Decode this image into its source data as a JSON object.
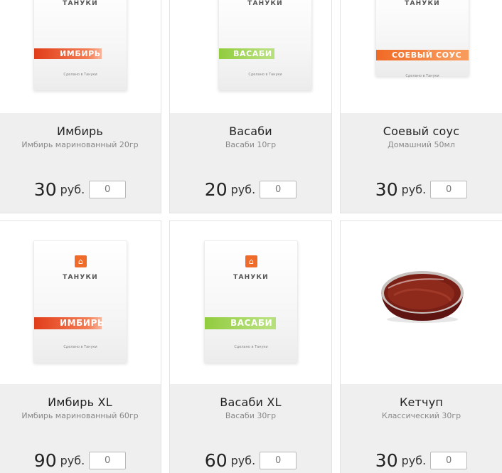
{
  "currency": "руб.",
  "brand": "ТАНУКИ",
  "made_in": "Сделано в Тануки",
  "products": [
    {
      "name": "Имбирь",
      "desc": "Имбирь маринованный 20гр",
      "price": "30",
      "qty": "0",
      "label": "ИМБИРЬ"
    },
    {
      "name": "Васаби",
      "desc": "Васаби 10гр",
      "price": "20",
      "qty": "0",
      "label": "ВАСАБИ"
    },
    {
      "name": "Соевый соус",
      "desc": "Домашний 50мл",
      "price": "30",
      "qty": "0",
      "label": "СОЕВЫЙ СОУС"
    },
    {
      "name": "Имбирь XL",
      "desc": "Имбирь маринованный 60гр",
      "price": "90",
      "qty": "0",
      "label": "ИМБИРЬ"
    },
    {
      "name": "Васаби XL",
      "desc": "Васаби 30гр",
      "price": "60",
      "qty": "0",
      "label": "ВАСАБИ"
    },
    {
      "name": "Кетчуп",
      "desc": "Классический 30гр",
      "price": "30",
      "qty": "0"
    }
  ],
  "colors": {
    "ginger": "#e8532a",
    "wasabi": "#9acd4a",
    "soy": "#f27a35",
    "info_bg": "#efefef",
    "border": "#e2e2e2"
  }
}
